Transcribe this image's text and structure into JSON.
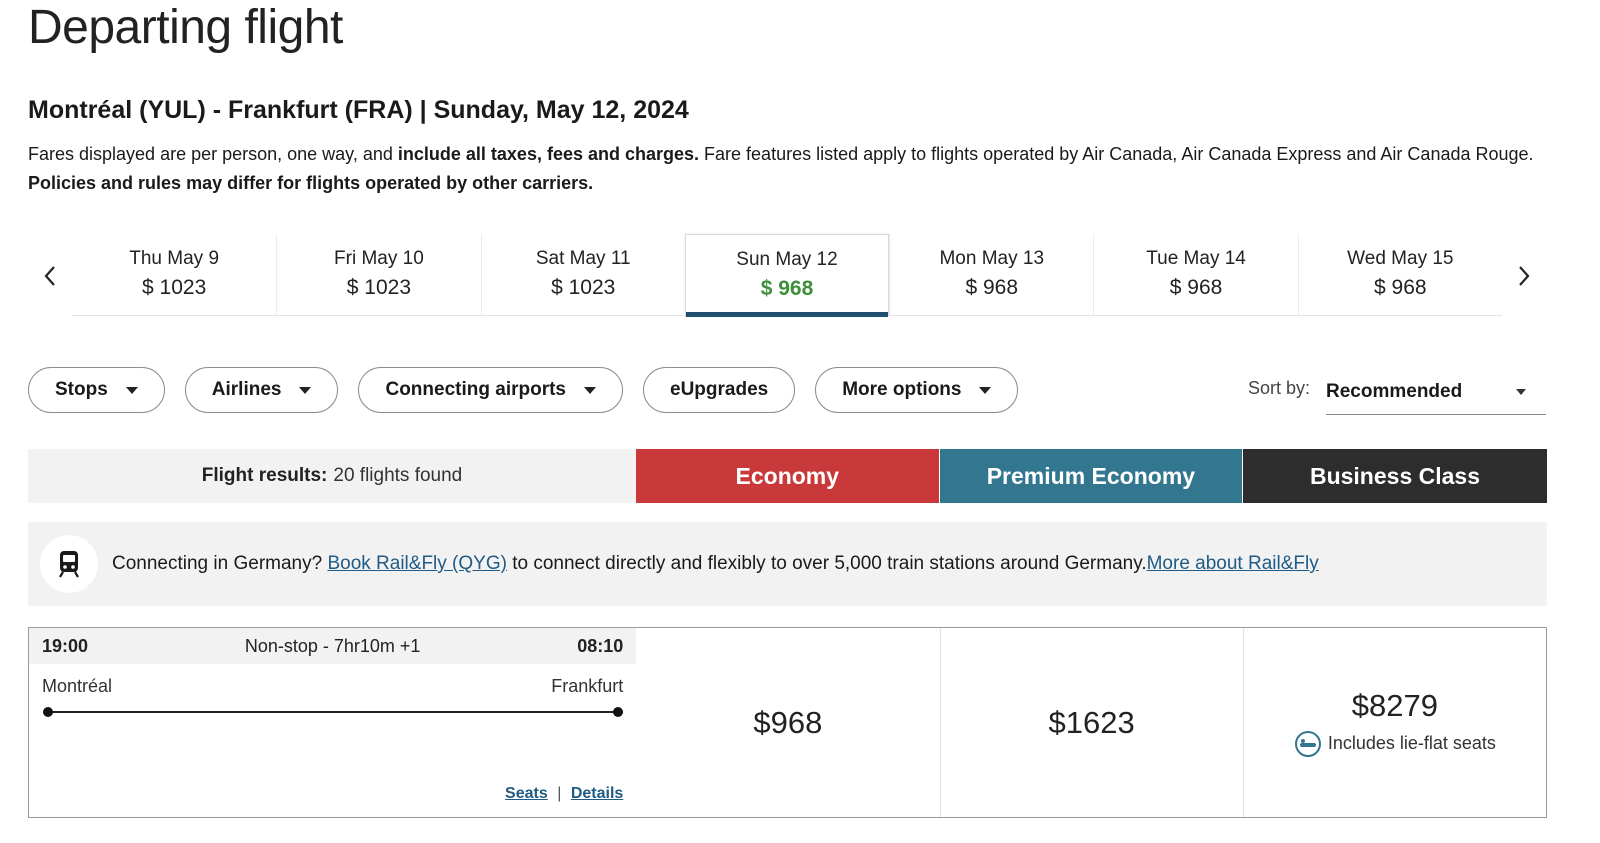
{
  "header": {
    "title": "Departing flight",
    "route": "Montréal (YUL) - Frankfurt (FRA) | Sunday, May 12, 2024",
    "note_part1": "Fares displayed are per person, one way, and ",
    "note_bold1": "include all taxes, fees and charges.",
    "note_part2": " Fare features listed apply to flights operated by Air Canada, Air Canada Express and Air Canada Rouge. ",
    "note_bold2": "Policies and rules may differ for flights operated by other carriers."
  },
  "dates": [
    {
      "label": "Thu May 9",
      "price": "$ 1023"
    },
    {
      "label": "Fri May 10",
      "price": "$ 1023"
    },
    {
      "label": "Sat May 11",
      "price": "$ 1023"
    },
    {
      "label": "Sun May 12",
      "price": "$ 968"
    },
    {
      "label": "Mon May 13",
      "price": "$ 968"
    },
    {
      "label": "Tue May 14",
      "price": "$ 968"
    },
    {
      "label": "Wed May 15",
      "price": "$ 968"
    }
  ],
  "selected_date_index": 3,
  "filters": {
    "stops": "Stops",
    "airlines": "Airlines",
    "connecting": "Connecting airports",
    "eupgrades": "eUpgrades",
    "more": "More options"
  },
  "sort": {
    "label": "Sort by:",
    "value": "Recommended"
  },
  "results": {
    "label": "Flight results:",
    "count": "20 flights found"
  },
  "cabins": {
    "economy": "Economy",
    "premium": "Premium Economy",
    "business": "Business Class"
  },
  "rail": {
    "text1": "Connecting in Germany? ",
    "link1": "Book Rail&Fly (QYG)",
    "text2": " to connect directly and flexibly to over 5,000 train stations around Germany.",
    "link2": "More about Rail&Fly"
  },
  "flight": {
    "depart_time": "19:00",
    "duration": "Non-stop - 7hr10m +1",
    "arrive_time": "08:10",
    "origin": "Montréal",
    "destination": "Frankfurt",
    "seats": "Seats",
    "separator": "|",
    "details": "Details",
    "economy_price": "$968",
    "premium_price": "$1623",
    "business_price": "$8279",
    "business_note": "Includes lie-flat seats"
  },
  "colors": {
    "economy": "#c9393a",
    "premium": "#33768f",
    "business": "#2d2d2d",
    "selected_price": "#3f8f3a",
    "link": "#1f5b84"
  },
  "icons": [
    "chevron-left-icon",
    "chevron-right-icon",
    "caret-down-icon",
    "train-icon",
    "lie-flat-seat-icon"
  ]
}
